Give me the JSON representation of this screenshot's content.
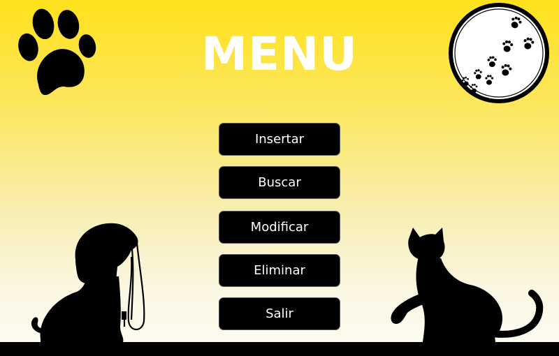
{
  "header": {
    "title": "MENU"
  },
  "menu": {
    "items": [
      {
        "label": "Insertar"
      },
      {
        "label": "Buscar"
      },
      {
        "label": "Modificar"
      },
      {
        "label": "Eliminar"
      },
      {
        "label": "Salir"
      }
    ]
  },
  "icons": {
    "top_left": "paw-print-icon",
    "top_right": "paw-trail-badge-icon",
    "bottom_left": "dog-with-leash-silhouette",
    "bottom_right": "cat-silhouette"
  },
  "colors": {
    "background_top": "#ffe11c",
    "background_bottom": "#fdfcf2",
    "button_bg": "#000000",
    "button_text": "#ffffff",
    "title_text": "#ffffff"
  }
}
